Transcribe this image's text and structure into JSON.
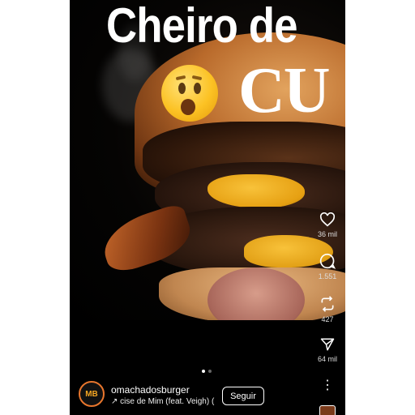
{
  "post": {
    "headline_line1": "Cheiro de",
    "headline_line2": "CU"
  },
  "carousel": {
    "count": 2,
    "active_index": 0
  },
  "actions": {
    "likes": "36 mil",
    "comments": "1.551",
    "reposts": "427",
    "shares": "64 mil"
  },
  "account": {
    "avatar_text": "MB",
    "username": "omachadosburger",
    "music": "↗ cise de Mim (feat. Veigh) (F",
    "follow_label": "Seguir"
  },
  "colors": {
    "background": "#000000",
    "accent_avatar_ring": "#e8762d",
    "cheese": "#f8c23a"
  },
  "icons": [
    "heart-icon",
    "comment-icon",
    "repost-icon",
    "share-icon",
    "more-icon"
  ]
}
